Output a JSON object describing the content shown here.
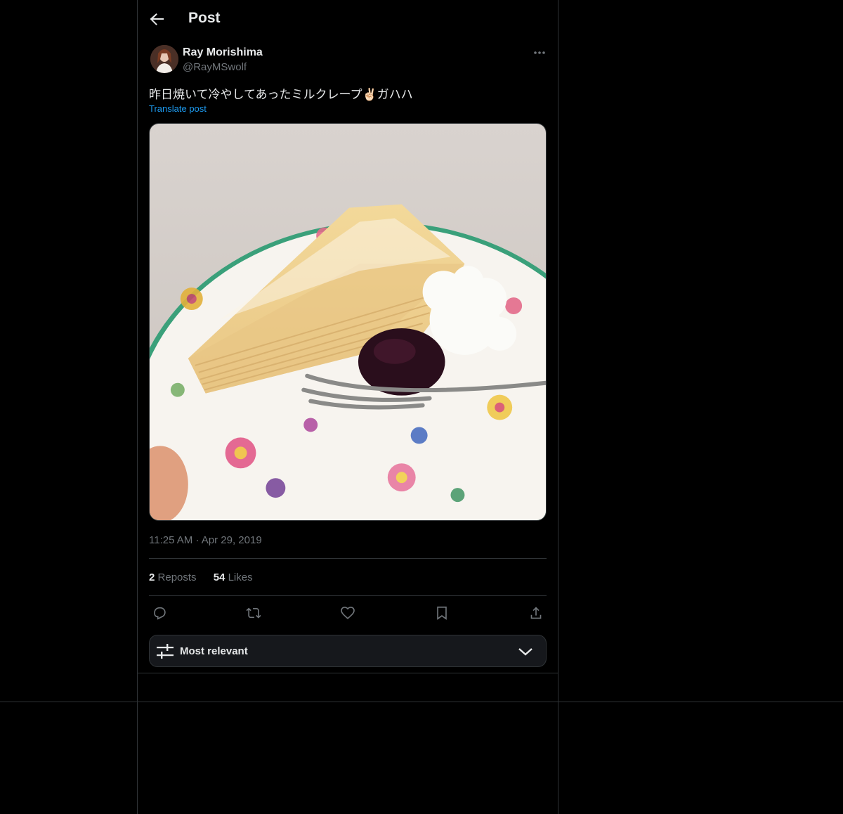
{
  "header": {
    "title": "Post",
    "back_icon": "arrow-left-icon"
  },
  "author": {
    "display_name": "Ray Morishima",
    "handle": "@RayMSwolf"
  },
  "post": {
    "text": "昨日焼いて冷やしてあったミルクレープ✌🏻ガハハ",
    "translate_label": "Translate post",
    "time": "11:25 AM",
    "separator": "·",
    "date": "Apr 29, 2019"
  },
  "stats": {
    "reposts_count": "2",
    "reposts_label": "Reposts",
    "likes_count": "54",
    "likes_label": "Likes"
  },
  "actions": [
    "reply-icon",
    "repost-icon",
    "like-icon",
    "bookmark-icon",
    "share-icon"
  ],
  "sort": {
    "label": "Most relevant"
  },
  "colors": {
    "background": "#000000",
    "text": "#e7e9ea",
    "muted": "#71767b",
    "link": "#1d9bf0",
    "border": "#2f3336"
  }
}
